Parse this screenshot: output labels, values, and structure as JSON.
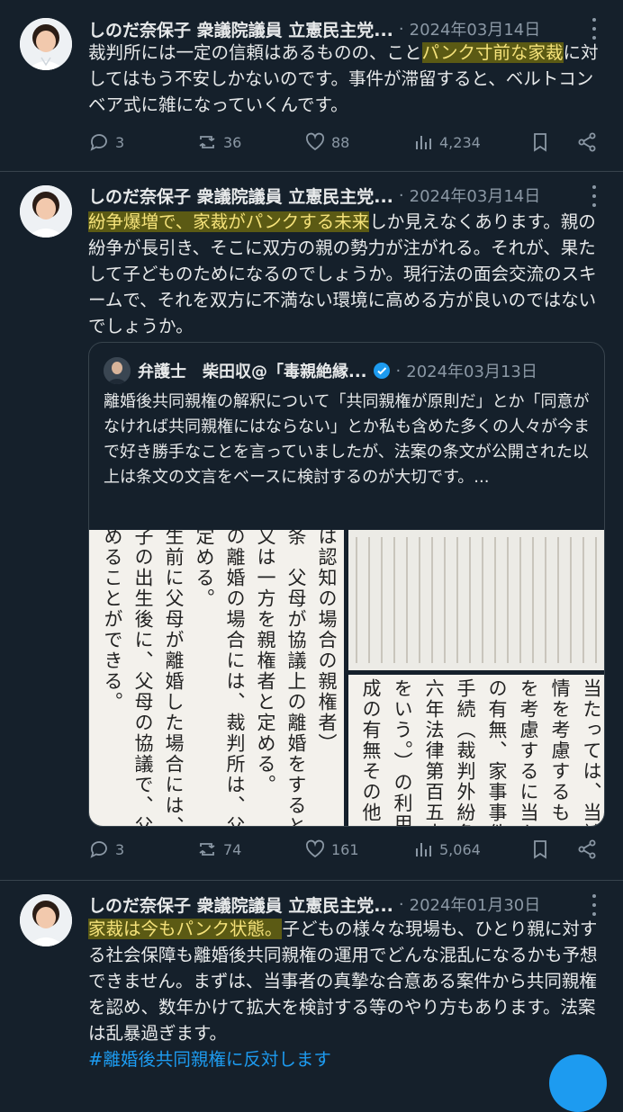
{
  "tweets": [
    {
      "author": "しのだ奈保子 衆議院議員 立憲民主党...",
      "date": "2024年03月14日",
      "segments": [
        {
          "text": "裁判所には一定の信頼はあるものの、こと",
          "hl": false
        },
        {
          "text": "パンク寸前な家裁",
          "hl": true
        },
        {
          "text": "に対してはもう不安しかないのです。事件が滞留すると、ベルトコンベア式に雑になっていくんです。",
          "hl": false
        }
      ],
      "replies": "3",
      "retweets": "36",
      "likes": "88",
      "views": "4,234"
    },
    {
      "author": "しのだ奈保子 衆議院議員 立憲民主党...",
      "date": "2024年03月14日",
      "segments": [
        {
          "text": "紛争爆増で、家裁がパンクする未来",
          "hl": true
        },
        {
          "text": "しか見えなくあります。親の紛争が長引き、そこに双方の親の勢力が注がれる。それが、果たして子どものためになるのでしょうか。現行法の面会交流のスキームで、それを双方に不満ない環境に高める方が良いのではないでしょうか。",
          "hl": false
        }
      ],
      "quote": {
        "author": "弁護士　柴田収@「毒親絶縁...",
        "date": "2024年03月13日",
        "text": "離婚後共同親権の解釈について「共同親権が原則だ」とか「同意がなければ共同親権にはならない」とか私も含めた多くの人々が今まで好き勝手なことを言っていましたが、法案の条文が公開された以上は条文の文言をベースに検討するのが大切です。...",
        "image_left_columns": [
          "は認知の場合の親権者）",
          "条　父母が協議上の離婚をするときは、そ",
          "又は一方を親権者と定める。",
          "の離婚の場合には、裁判所は、父母の双方",
          "定める。",
          "生前に父母が離婚した場合には、親権は、",
          "子の出生後に、父母の協議で、父母の双方",
          "めることができる。"
        ],
        "image_right_columns": [
          "当たっては、当該協議の",
          "情を考慮するものとする",
          "を考慮するに当たっては",
          "の有無、家事事件手続法",
          "手続（裁判外紛争解決手",
          "六年法律第百五十一号）",
          "をいう。）の利用の有無",
          "成の有無その他の事情を"
        ]
      },
      "replies": "3",
      "retweets": "74",
      "likes": "161",
      "views": "5,064"
    },
    {
      "author": "しのだ奈保子 衆議院議員 立憲民主党...",
      "date": "2024年01月30日",
      "segments": [
        {
          "text": "家裁は今もパンク状態。",
          "hl": true
        },
        {
          "text": "子どもの様々な現場も、ひとり親に対する社会保障も離婚後共同親権の運用でどんな混乱になるかも予想できません。まずは、当事者の真摯な合意ある案件から共同親権を認め、数年かけて拡大を検討する等のやり方もあります。法案は乱暴過ぎます。",
          "hl": false
        }
      ],
      "hashtag": "#離婚後共同親権に反対します"
    }
  ],
  "icons": [
    "reply-icon",
    "retweet-icon",
    "like-icon",
    "views-icon",
    "bookmark-icon",
    "share-icon",
    "more-icon",
    "verified-icon"
  ],
  "colors": {
    "background": "#15202b",
    "text": "#e7e9ea",
    "muted": "#8b98a5",
    "accent": "#1d9bf0",
    "highlight": "#5b5a14"
  }
}
